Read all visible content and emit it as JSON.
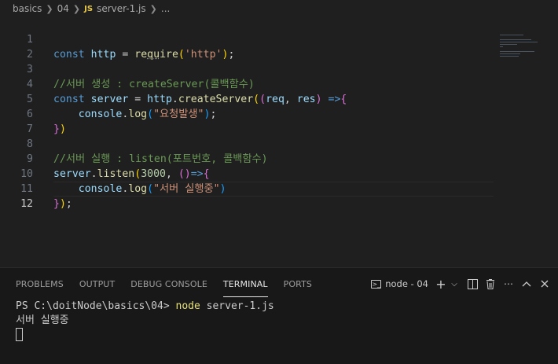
{
  "breadcrumb": {
    "items": [
      "basics",
      "04"
    ],
    "file_icon": "JS",
    "file": "server-1.js",
    "trailing": "..."
  },
  "editor": {
    "lines": [
      {
        "num": "1"
      },
      {
        "num": "2"
      },
      {
        "num": "3"
      },
      {
        "num": "4"
      },
      {
        "num": "5"
      },
      {
        "num": "6"
      },
      {
        "num": "7"
      },
      {
        "num": "8"
      },
      {
        "num": "9"
      },
      {
        "num": "10"
      },
      {
        "num": "11"
      },
      {
        "num": "12"
      }
    ],
    "tokens": {
      "l1_kw": "const",
      "l1_var": "http",
      "l1_eq": "=",
      "l1_fn_a": "re",
      "l1_fn_b": "qu",
      "l1_fn_c": "ire",
      "l1_str": "'http'",
      "l3_com": "//서버 생성 : createServer(콜백함수)",
      "l4_kw": "const",
      "l4_var": "server",
      "l4_eq": "=",
      "l4_obj": "http",
      "l4_fn": "createServer",
      "l4_p1": "req",
      "l4_p2": "res",
      "l5_obj": "console",
      "l5_fn": "log",
      "l5_str": "\"요청발생\"",
      "l8_com": "//서버 실행 : listen(포트번호, 콜백함수)",
      "l9_obj": "server",
      "l9_fn": "listen",
      "l9_num": "3000",
      "l10_obj": "console",
      "l10_fn": "log",
      "l10_str": "\"서버 실행중\""
    }
  },
  "panel": {
    "tabs": [
      "PROBLEMS",
      "OUTPUT",
      "DEBUG CONSOLE",
      "TERMINAL",
      "PORTS"
    ],
    "active_tab": "TERMINAL",
    "terminal_name": "node - 04",
    "terminal": {
      "prompt": "PS C:\\doitNode\\basics\\04> ",
      "command": "node",
      "args": " server-1.js",
      "output": "서버 실행중"
    }
  },
  "icons": {
    "terminal": "terminal-icon",
    "add": "plus-icon",
    "dropdown": "chevron-down-icon",
    "split": "split-editor-icon",
    "trash": "trash-icon",
    "more": "ellipsis-icon",
    "maximize": "chevron-up-icon",
    "close": "close-icon"
  },
  "colors": {
    "keyword": "#569cd6",
    "variable": "#9cdcfe",
    "function": "#dcdcaa",
    "string": "#ce9178",
    "comment": "#6a9955",
    "number": "#b5cea8"
  }
}
